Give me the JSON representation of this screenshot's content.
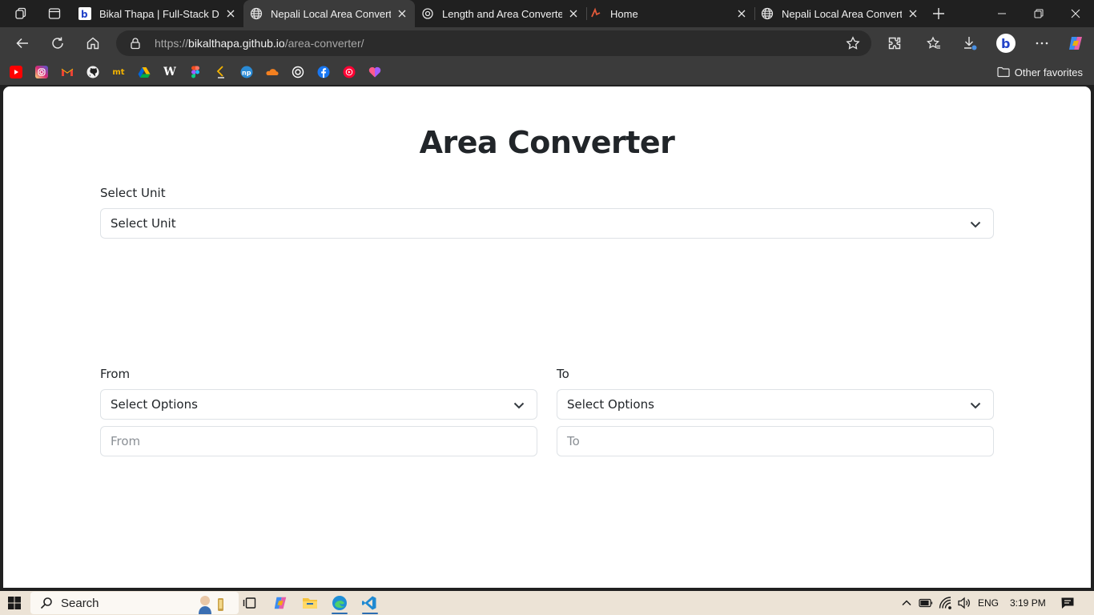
{
  "browser": {
    "tabs": [
      {
        "title": "Bikal Thapa | Full-Stack Deve",
        "favicon": "bt-logo-icon",
        "active": false
      },
      {
        "title": "Nepali Local Area Converter",
        "favicon": "globe-icon",
        "active": true
      },
      {
        "title": "Length and Area Converter",
        "favicon": "openai-icon",
        "active": false
      },
      {
        "title": "Home",
        "favicon": "site-logo-icon",
        "active": false
      },
      {
        "title": "Nepali Local Area Converter",
        "favicon": "globe-icon",
        "active": false
      }
    ],
    "url": {
      "prefix": "https://",
      "host": "bikalthapa.github.io",
      "path": "/area-converter/"
    },
    "other_favorites": "Other favorites",
    "favorites": [
      {
        "name": "youtube-icon",
        "color": "#ff0000"
      },
      {
        "name": "instagram-icon",
        "color": "#d62976"
      },
      {
        "name": "gmail-icon",
        "color": "#ea4335"
      },
      {
        "name": "github-icon",
        "color": "#f0f0f0"
      },
      {
        "name": "mt-icon",
        "color": "#f5b400"
      },
      {
        "name": "google-drive-icon",
        "color": "#1fa463"
      },
      {
        "name": "wikipedia-icon",
        "color": "#ffffff"
      },
      {
        "name": "figma-icon",
        "color": "#a259ff"
      },
      {
        "name": "codeforces-icon",
        "color": "#f5b400"
      },
      {
        "name": "np-icon",
        "color": "#2a8bd6"
      },
      {
        "name": "cloudflare-icon",
        "color": "#f38020"
      },
      {
        "name": "openai-icon",
        "color": "#ffffff"
      },
      {
        "name": "facebook-icon",
        "color": "#1877f2"
      },
      {
        "name": "youtube-music-icon",
        "color": "#ff0033"
      },
      {
        "name": "heart-app-icon",
        "color": "#ff5a8a"
      }
    ]
  },
  "page": {
    "title": "Area Converter",
    "select_unit_label": "Select Unit",
    "select_unit_value": "Select Unit",
    "from_label": "From",
    "to_label": "To",
    "from_select_value": "Select Options",
    "to_select_value": "Select Options",
    "from_placeholder": "From",
    "to_placeholder": "To"
  },
  "taskbar": {
    "search_label": "Search",
    "language": "ENG",
    "time": "3:19 PM"
  }
}
